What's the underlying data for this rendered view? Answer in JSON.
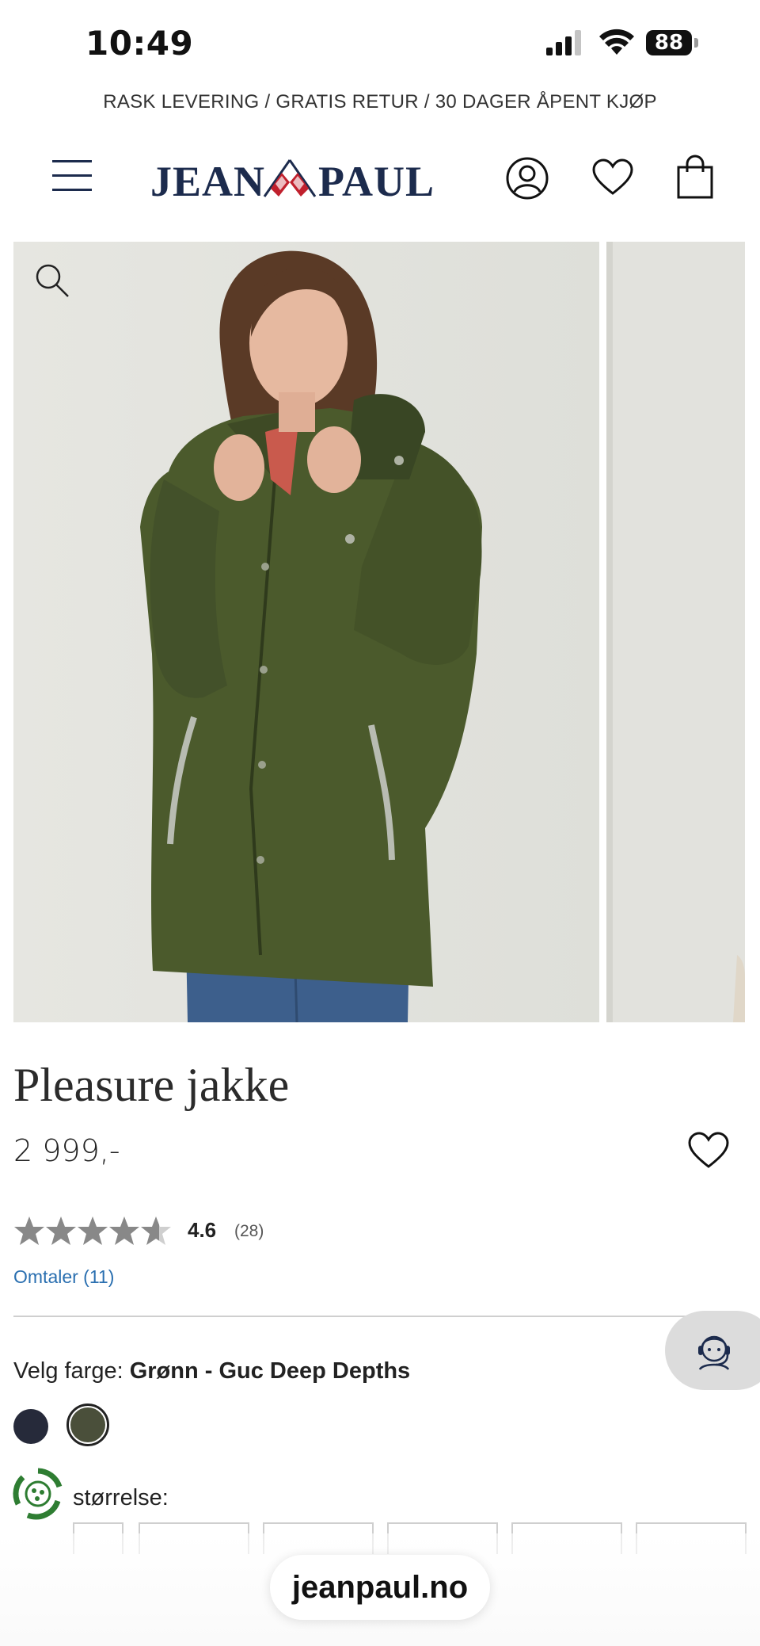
{
  "status_bar": {
    "time": "10:49",
    "battery": "88"
  },
  "promo": {
    "text": "RASK LEVERING / GRATIS RETUR / 30 DAGER ÅPENT KJØP"
  },
  "header": {
    "logo_left": "JEAN",
    "logo_right": "PAUL",
    "menu_icon": "hamburger-menu-icon",
    "account_icon": "user-icon",
    "wishlist_icon": "heart-icon",
    "cart_icon": "shopping-bag-icon"
  },
  "product": {
    "name": "Pleasure jakke",
    "price": "2 999,-",
    "rating": "4.6",
    "rating_fraction": 0.92,
    "rating_count": "(28)",
    "reviews_link": "Omtaler (11)",
    "color_label": "Velg farge: ",
    "color_value": "Grønn - Guc Deep Depths",
    "swatches": [
      {
        "name": "navy",
        "color": "#262a3a",
        "selected": false
      },
      {
        "name": "green",
        "color": "#4a4f3a",
        "selected": true
      }
    ],
    "size_label": "størrelse:"
  },
  "colors": {
    "brand_navy": "#1c2b4d",
    "link_blue": "#2a6fb0",
    "jacket_green": "#4b5a2c",
    "eco_green": "#2e7d32"
  },
  "browser": {
    "url": "jeanpaul.no"
  }
}
